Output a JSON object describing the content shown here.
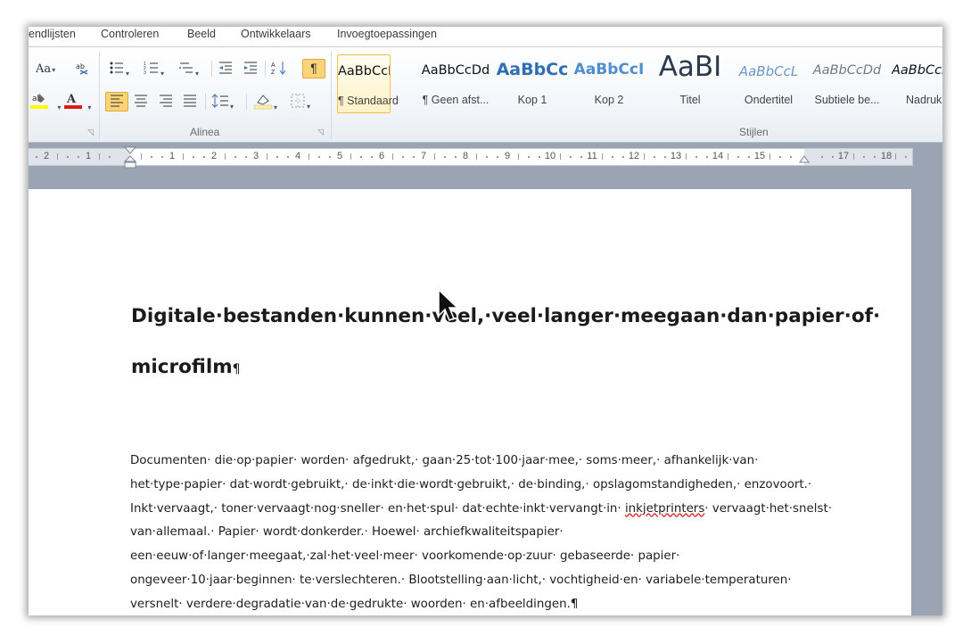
{
  "ribbon": {
    "tabs": [
      "endlijsten",
      "Controleren",
      "Beeld",
      "Ontwikkelaars",
      "Invoegtoepassingen"
    ],
    "groups": {
      "paragraph": "Alinea",
      "styles": "Stijlen"
    },
    "font_size_label": "Aa",
    "styles": [
      {
        "sample": "AaBbCcDd",
        "name": "¶ Standaard"
      },
      {
        "sample": "AaBbCcDd",
        "name": "¶ Geen afst..."
      },
      {
        "sample": "AaBbCc",
        "name": "Kop 1"
      },
      {
        "sample": "AaBbCcI",
        "name": "Kop 2"
      },
      {
        "sample": "AaBI",
        "name": "Titel"
      },
      {
        "sample": "AaBbCcL",
        "name": "Ondertitel"
      },
      {
        "sample": "AaBbCcDd",
        "name": "Subtiele be..."
      },
      {
        "sample": "AaBbCcI",
        "name": "Nadruk"
      }
    ],
    "selected_style": "¶ Standaard"
  },
  "ruler": {
    "labels": [
      "2",
      "1",
      "1",
      "2",
      "3",
      "4",
      "5",
      "6",
      "7",
      "8",
      "9",
      "10",
      "11",
      "12",
      "13",
      "14",
      "15",
      "17",
      "18"
    ]
  },
  "document": {
    "heading_line1": "Digitale·bestanden·kunnen·veel,·veel·langer·meegaan·dan·papier·of·",
    "heading_line2": "microfilm",
    "pilcrow": "¶",
    "paragraph": {
      "before_misspelling": "Documenten· die·op·papier· worden· afgedrukt,· gaan·25·tot·100·jaar·mee,· soms·meer,· afhankelijk·van· het·type·papier· dat·wordt·gebruikt,· de·inkt·die·wordt·gebruikt,· de·binding,· opslagomstandigheden,· enzovoort.· Inkt·vervaagt,· toner·vervaagt·nog·sneller· en·het·spul· dat·echte·inkt·vervangt·in· ",
      "misspelled_word": "inkjetprinters",
      "after_misspelling": "· vervaagt·het·snelst· van·allemaal.· Papier· wordt·donkerder.· Hoewel· archiefkwaliteitspapier· een·eeuw·of·langer·meegaat,·zal·het·veel·meer· voorkomende·op·zuur· gebaseerde· papier· ongeveer·10·jaar·beginnen· te·verslechteren.· Blootstelling·aan·licht,· vochtigheid·en· variabele·temperaturen· versnelt· verdere·degradatie·van·de·gedrukte· woorden· en·afbeeldingen.",
      "end_mark": "¶"
    }
  },
  "colors": {
    "highlight_yellow": "#ffff00",
    "font_color_red": "#e01b1b",
    "pilcrow_button": "#fbd479",
    "page_background": "#9aa4b2"
  }
}
